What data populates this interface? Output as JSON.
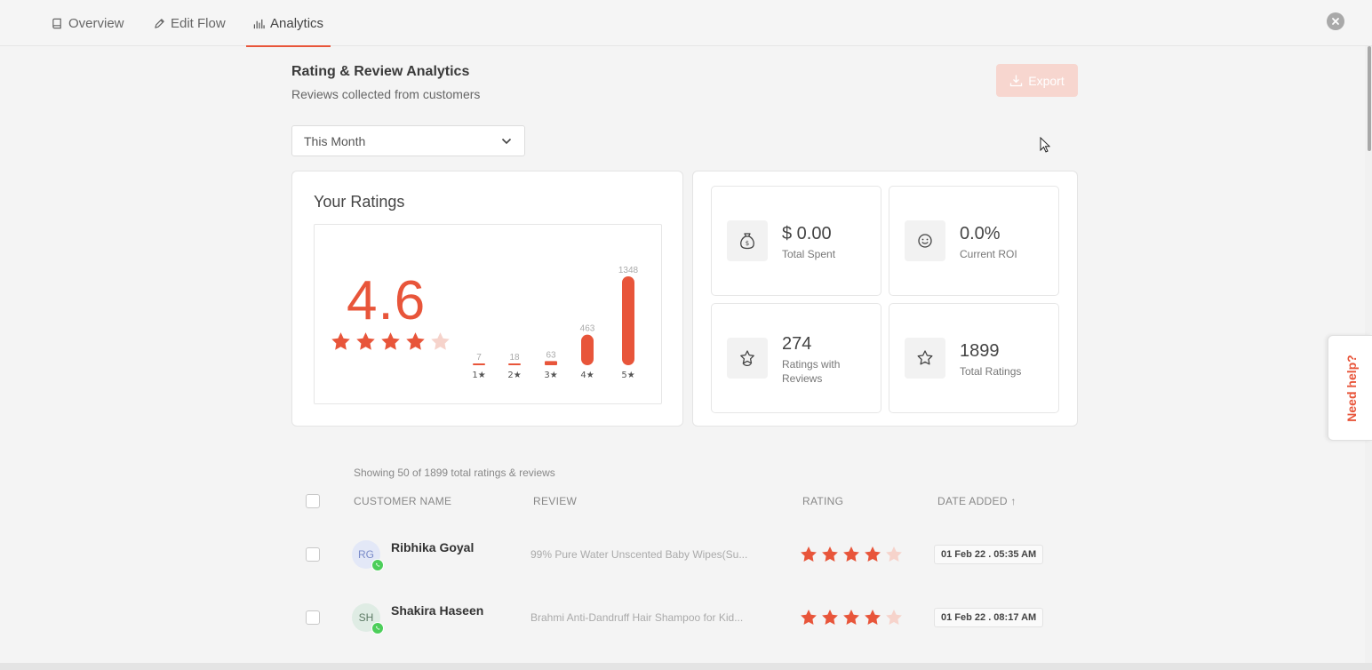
{
  "tabs": [
    {
      "label": "Overview",
      "icon": "book-icon",
      "active": false
    },
    {
      "label": "Edit Flow",
      "icon": "pencil-icon",
      "active": false
    },
    {
      "label": "Analytics",
      "icon": "bar-chart-icon",
      "active": true
    }
  ],
  "header": {
    "title": "Rating & Review Analytics",
    "subtitle": "Reviews collected from customers",
    "export_label": "Export"
  },
  "filter": {
    "selected": "This Month"
  },
  "ratings": {
    "title": "Your Ratings",
    "average": "4.6",
    "average_value": 4.6,
    "distribution": [
      {
        "label": "1★",
        "count": 7
      },
      {
        "label": "2★",
        "count": 18
      },
      {
        "label": "3★",
        "count": 63
      },
      {
        "label": "4★",
        "count": 463
      },
      {
        "label": "5★",
        "count": 1348
      }
    ]
  },
  "stats": {
    "total_spent": {
      "value": "$ 0.00",
      "label": "Total Spent",
      "icon": "money-bag-icon"
    },
    "current_roi": {
      "value": "0.0%",
      "label": "Current ROI",
      "icon": "smiley-icon"
    },
    "ratings_with_reviews": {
      "value": "274",
      "label": "Ratings with Reviews",
      "icon": "star-badge-icon"
    },
    "total_ratings": {
      "value": "1899",
      "label": "Total Ratings",
      "icon": "star-icon"
    }
  },
  "table": {
    "showing": "Showing 50 of 1899 total ratings & reviews",
    "columns": {
      "customer": "CUSTOMER NAME",
      "review": "REVIEW",
      "rating": "RATING",
      "date": "DATE ADDED ↑"
    },
    "rows": [
      {
        "initials": "RG",
        "name": "Ribhika Goyal",
        "review": "99% Pure Water Unscented Baby Wipes(Su...",
        "rating": 4,
        "date": "01 Feb 22 . 05:35 AM",
        "avatar_color": "#e3e8f7",
        "initials_color": "#7a8bc9"
      },
      {
        "initials": "SH",
        "name": "Shakira Haseen",
        "review": "Brahmi Anti-Dandruff Hair Shampoo for Kid...",
        "rating": 4,
        "date": "01 Feb 22 . 08:17 AM",
        "avatar_color": "#dfece4",
        "initials_color": "#5c7a64"
      }
    ]
  },
  "help": {
    "label": "Need help?"
  },
  "colors": {
    "accent": "#e8553a",
    "star_empty": "#f6d3cb"
  }
}
